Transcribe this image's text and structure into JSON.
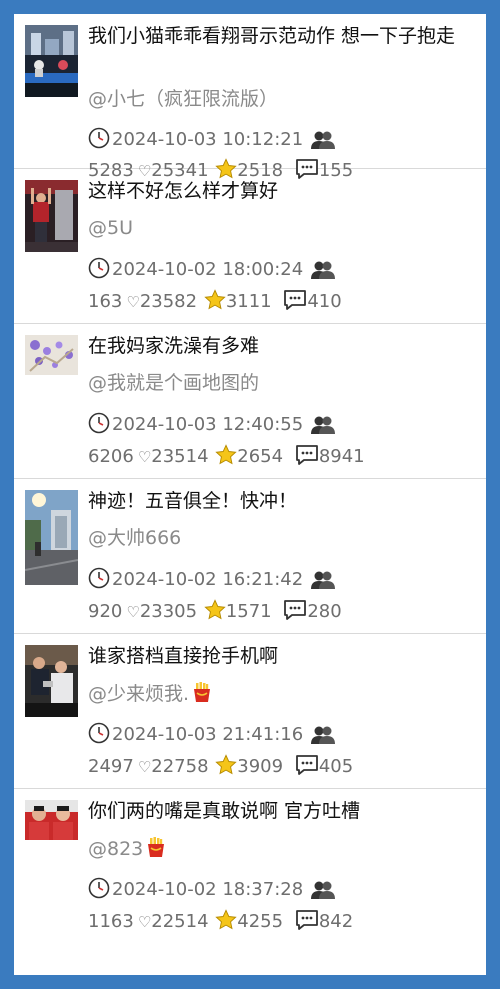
{
  "icons": {
    "clock": "clock-icon",
    "people": "people-icon",
    "heart": "heart-icon",
    "star": "star-icon",
    "comment": "comment-icon",
    "fries": "fries-icon"
  },
  "heart_glyph": "♡",
  "feed": [
    {
      "title": "我们小猫乖乖看翔哥示范动作 想一下子抱走",
      "author": "@小七（疯狂限流版）",
      "badge": false,
      "time": "2024-10-03 10:12:21",
      "views": "5283",
      "likes": "25341",
      "stars": "2518",
      "comments": "155"
    },
    {
      "title": "这样不好怎么样才算好",
      "author": "@5U",
      "badge": false,
      "time": "2024-10-02 18:00:24",
      "views": "163",
      "likes": "23582",
      "stars": "3111",
      "comments": "410"
    },
    {
      "title": "在我妈家洗澡有多难",
      "author": "@我就是个画地图的",
      "badge": false,
      "time": "2024-10-03 12:40:55",
      "views": "6206",
      "likes": "23514",
      "stars": "2654",
      "comments": "8941"
    },
    {
      "title": "神迹！五音俱全！快冲！",
      "author": "@大帅666",
      "badge": false,
      "time": "2024-10-02 16:21:42",
      "views": "920",
      "likes": "23305",
      "stars": "1571",
      "comments": "280"
    },
    {
      "title": "谁家搭档直接抢手机啊",
      "author": "@少来烦我.",
      "badge": true,
      "time": "2024-10-03 21:41:16",
      "views": "2497",
      "likes": "22758",
      "stars": "3909",
      "comments": "405"
    },
    {
      "title": "你们两的嘴是真敢说啊 官方吐槽",
      "author": "@823",
      "badge": true,
      "time": "2024-10-02 18:37:28",
      "views": "1163",
      "likes": "22514",
      "stars": "4255",
      "comments": "842"
    }
  ]
}
